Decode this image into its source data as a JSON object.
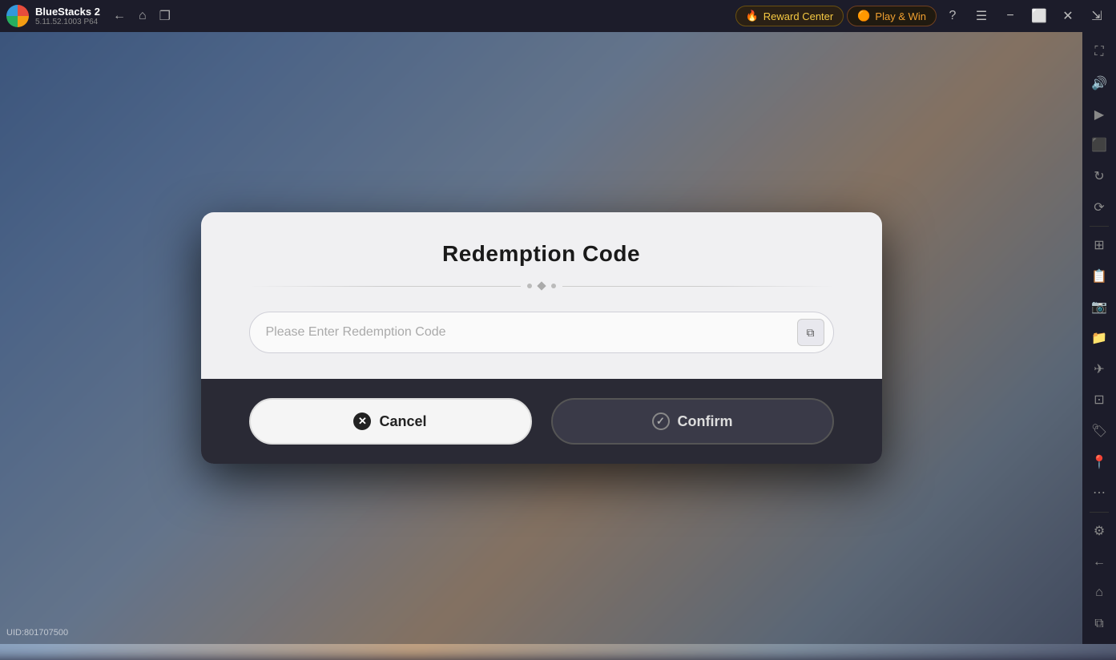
{
  "app": {
    "name": "BlueStacks 2",
    "version": "5.11.52.1003",
    "build": "P64",
    "uid": "UID:801707500"
  },
  "topbar": {
    "back_label": "←",
    "home_label": "⌂",
    "multi_label": "❐",
    "reward_center_label": "Reward Center",
    "play_win_label": "Play & Win",
    "help_label": "?",
    "menu_label": "☰",
    "minimize_label": "−",
    "restore_label": "⬜",
    "close_label": "✕",
    "expand_label": "⇲"
  },
  "sidebar": {
    "icons": [
      {
        "name": "expand-icon",
        "symbol": "⛶"
      },
      {
        "name": "volume-icon",
        "symbol": "🔊"
      },
      {
        "name": "screen-icon",
        "symbol": "▶"
      },
      {
        "name": "record-icon",
        "symbol": "⬛"
      },
      {
        "name": "refresh-icon",
        "symbol": "↻"
      },
      {
        "name": "rotate-icon",
        "symbol": "⟳"
      },
      {
        "name": "apps-icon",
        "symbol": "⊞"
      },
      {
        "name": "file-manager-icon",
        "symbol": "📋"
      },
      {
        "name": "screenshot-icon",
        "symbol": "📷"
      },
      {
        "name": "folder-icon",
        "symbol": "📁"
      },
      {
        "name": "gamepad-icon",
        "symbol": "✈"
      },
      {
        "name": "resize-icon",
        "symbol": "⊡"
      },
      {
        "name": "label-icon",
        "symbol": "🏷"
      },
      {
        "name": "location-icon",
        "symbol": "📍"
      },
      {
        "name": "more-icon",
        "symbol": "⋯"
      },
      {
        "name": "settings-icon",
        "symbol": "⚙"
      },
      {
        "name": "back-icon",
        "symbol": "←"
      },
      {
        "name": "home-sidebar-icon",
        "symbol": "⌂"
      },
      {
        "name": "copy-icon",
        "symbol": "⧉"
      }
    ]
  },
  "modal": {
    "title": "Redemption Code",
    "input_placeholder": "Please Enter Redemption Code",
    "cancel_label": "Cancel",
    "confirm_label": "Confirm",
    "paste_icon": "⧉"
  }
}
